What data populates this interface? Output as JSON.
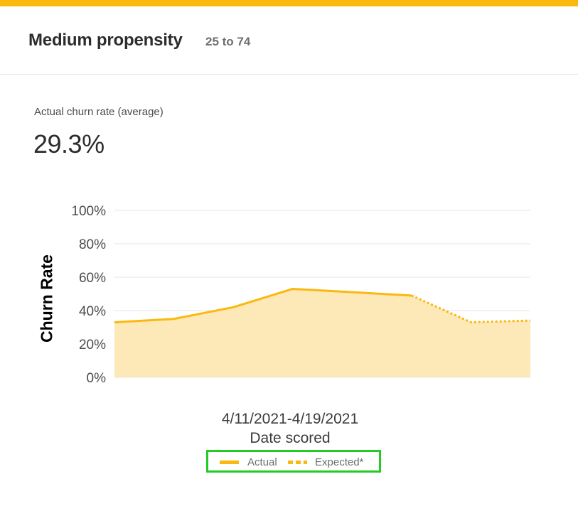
{
  "header": {
    "title": "Medium propensity",
    "range": "25 to 74"
  },
  "metric": {
    "label": "Actual churn rate (average)",
    "value": "29.3%"
  },
  "legend": {
    "actual_label": "Actual",
    "expected_label": "Expected*"
  },
  "colors": {
    "accent": "#fbb80f",
    "area_fill": "#fde8b8",
    "legend_highlight": "#22cc22",
    "grid": "#e6e6e6"
  },
  "chart_data": {
    "type": "area",
    "title": "",
    "xlabel": "Date scored",
    "ylabel": "Churn Rate",
    "categories": [
      "4/11/2021-4/19/2021"
    ],
    "ylim": [
      0,
      100
    ],
    "yticks": [
      "0%",
      "20%",
      "40%",
      "60%",
      "80%",
      "100%"
    ],
    "yticks_values": [
      0,
      20,
      40,
      60,
      80,
      100
    ],
    "grid": true,
    "legend_position": "bottom-center",
    "series": [
      {
        "name": "Actual",
        "style": "solid",
        "values": [
          33,
          35,
          42,
          53,
          51,
          49
        ]
      },
      {
        "name": "Expected*",
        "style": "dotted",
        "values": [
          49,
          33,
          34
        ]
      }
    ]
  }
}
